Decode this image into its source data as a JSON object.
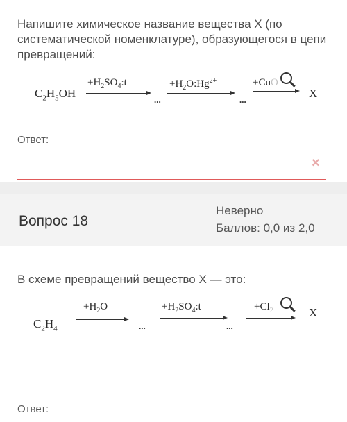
{
  "q1": {
    "prompt": "Напишите химическое название вещества X (по систематической номенклатуре), образующегося в цепи превращений:",
    "start": "C2H5OH",
    "reagent1": "+H2SO4:t",
    "reagent2": "+H2O:Hg2+",
    "reagent3": "+CuO",
    "intermediate": "...",
    "product": "X",
    "answer_label": "Ответ:",
    "close_icon": "×"
  },
  "q2": {
    "number": "Вопрос 18",
    "status": "Неверно",
    "score": "Баллов: 0,0 из 2,0",
    "prompt": "В схеме превращений вещество X — это:",
    "start": "C2H4",
    "reagent1": "+H2O",
    "reagent2": "+H2SO4:t",
    "reagent3": "+Cl2",
    "intermediate": "...",
    "product": "X",
    "answer_label": "Ответ:"
  },
  "icons": [
    "magnifier-icon",
    "close-icon"
  ],
  "colors": {
    "error_line": "#e05a5a",
    "close_icon": "#e8a9a9"
  }
}
